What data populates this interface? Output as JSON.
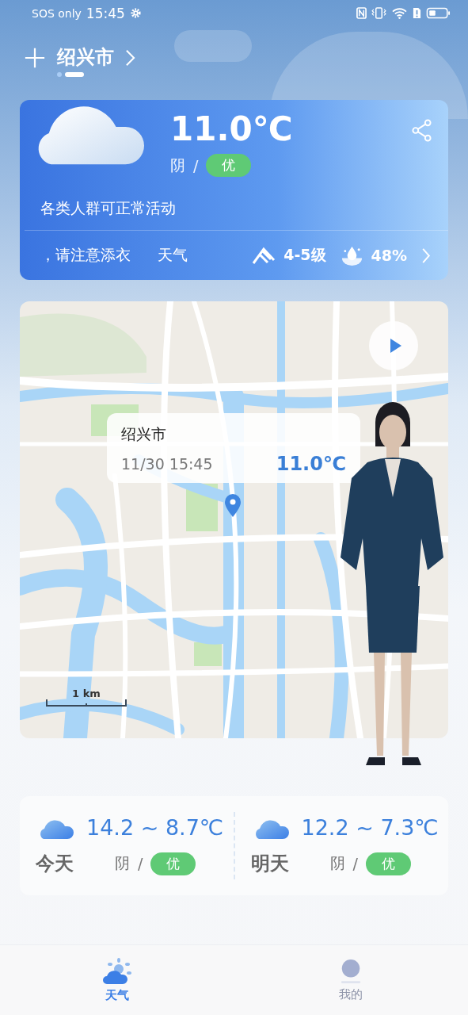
{
  "status_bar": {
    "carrier": "SOS only",
    "time": "15:45"
  },
  "header": {
    "city": "绍兴市",
    "pages": [
      {
        "selected": false
      },
      {
        "selected": true
      }
    ]
  },
  "current": {
    "temperature": "11.0℃",
    "condition": "阴",
    "separator": "/",
    "aqi": "优",
    "advice": "各类人群可正常活动",
    "ticker": "，请注意添衣",
    "ticker_2": "天气",
    "wind": "4-5级",
    "humidity": "48%"
  },
  "map": {
    "popup": {
      "city": "绍兴市",
      "time": "11/30 15:45",
      "temperature": "11.0℃"
    },
    "scale": "1 km"
  },
  "forecast": [
    {
      "day": "今天",
      "range": "14.2 ~ 8.7℃",
      "condition": "阴",
      "separator": "/",
      "aqi": "优"
    },
    {
      "day": "明天",
      "range": "12.2 ~ 7.3℃",
      "condition": "阴",
      "separator": "/",
      "aqi": "优"
    }
  ],
  "nav": [
    {
      "kind": "weather",
      "label": "天气",
      "selected": true
    },
    {
      "kind": "profile",
      "label": "我的",
      "selected": false
    }
  ]
}
